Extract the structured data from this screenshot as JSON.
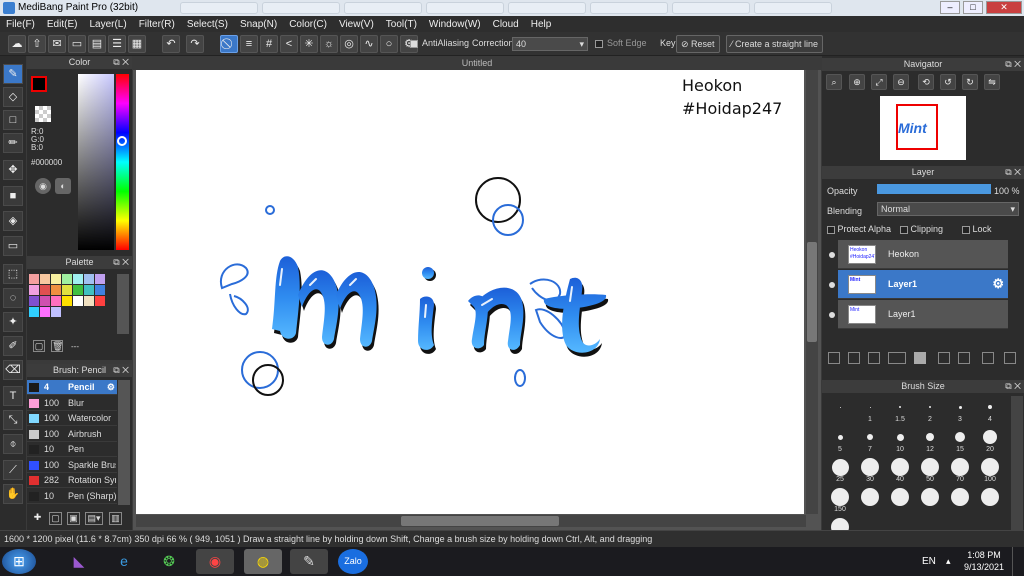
{
  "window": {
    "title": "MediBang Paint Pro (32bit)",
    "min": "–",
    "max": "□",
    "close": "✕"
  },
  "menu": [
    "File(F)",
    "Edit(E)",
    "Layer(L)",
    "Filter(R)",
    "Select(S)",
    "Snap(N)",
    "Color(C)",
    "View(V)",
    "Tool(T)",
    "Window(W)",
    "Cloud",
    "Help"
  ],
  "toolbar": {
    "antialiasing": "AntiAliasing",
    "correction_label": "Correction",
    "correction_value": "40",
    "soft_edge": "Soft Edge",
    "key": "Key",
    "reset": "Reset",
    "straight_line": "Create a straight line"
  },
  "color_panel": {
    "title": "Color",
    "r": "R:0",
    "g": "G:0",
    "b": "B:0",
    "hex": "#000000"
  },
  "palette": {
    "title": "Palette",
    "name": "---",
    "colors": [
      "#f4a0a0",
      "#f8c8a0",
      "#f8f0a0",
      "#a0f0a0",
      "#a0f0f0",
      "#a0c0f0",
      "#c0a0f0",
      "#f0a0e0",
      "#e05050",
      "#f09040",
      "#e0e040",
      "#40c040",
      "#40c0c0",
      "#4080e0",
      "#8050d0",
      "#d050b0",
      "#ff70c0",
      "#ffe000",
      "#ffffff",
      "#f0e0c0",
      "#ff4040",
      "#30d0ff",
      "#ff70ff",
      "#c0c0ff"
    ]
  },
  "brush_panel": {
    "title": "Brush: Pencil",
    "items": [
      {
        "num": "4",
        "name": "Pencil",
        "color": "#1a1a1a",
        "selected": true
      },
      {
        "num": "100",
        "name": "Blur",
        "color": "#ff9ed8"
      },
      {
        "num": "100",
        "name": "Watercolor",
        "color": "#80d8ff"
      },
      {
        "num": "100",
        "name": "Airbrush",
        "color": "#cccccc"
      },
      {
        "num": "10",
        "name": "Pen",
        "color": "#222222"
      },
      {
        "num": "100",
        "name": "Sparkle Brush",
        "color": "#3050ff"
      },
      {
        "num": "282",
        "name": "Rotation Sym",
        "color": "#e03030"
      },
      {
        "num": "10",
        "name": "Pen (Sharp)",
        "color": "#222222"
      }
    ]
  },
  "document": {
    "tab": "Untitled",
    "text_line1": "Heokon",
    "text_line2": "#Hoidap247",
    "artwork_text": "Mint"
  },
  "navigator": {
    "title": "Navigator"
  },
  "layer_panel": {
    "title": "Layer",
    "opacity_label": "Opacity",
    "opacity_value": "100 %",
    "opacity_fraction": 1.0,
    "blending_label": "Blending",
    "blending_value": "Normal",
    "protect_alpha": "Protect Alpha",
    "clipping": "Clipping",
    "lock": "Lock",
    "layers": [
      {
        "name": "Heokon",
        "thumb": "Heokon #Hoidap247",
        "selected": false
      },
      {
        "name": "Layer1",
        "thumb": "Mint",
        "selected": true
      },
      {
        "name": "Layer1",
        "thumb": "Mint",
        "selected": false
      }
    ]
  },
  "brush_size": {
    "title": "Brush Size",
    "sizes": [
      "",
      "1",
      "1.5",
      "2",
      "3",
      "4",
      "5",
      "7",
      "10",
      "12",
      "15",
      "20",
      "25",
      "30",
      "40",
      "50",
      "70",
      "100",
      "150",
      "",
      "",
      "",
      "",
      "",
      ""
    ]
  },
  "status": {
    "text": "1600 * 1200 pixel  (11.6 * 8.7cm)  350 dpi  66 %  ( 949, 1051 )  Draw a straight line by holding down Shift, Change a brush size by holding down Ctrl, Alt, and dragging"
  },
  "taskbar": {
    "lang": "EN",
    "time": "1:08 PM",
    "date": "9/13/2021",
    "zalo": "Zalo"
  },
  "colors": {
    "accent": "#3b78c8",
    "stroke_blue": "#2a6cd8",
    "highlight_blue": "#4aa8ff"
  }
}
